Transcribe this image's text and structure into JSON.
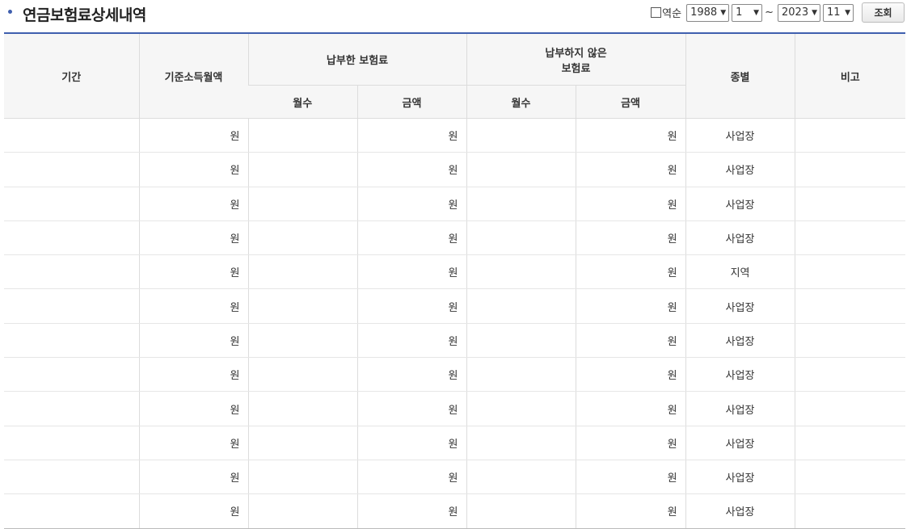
{
  "title": "연금보험료상세내역",
  "controls": {
    "reverse_label": "역순",
    "start_year": "1988",
    "start_month": "1",
    "tilde": "~",
    "end_year": "2023",
    "end_month": "11",
    "search_label": "조회"
  },
  "table": {
    "headers": {
      "period": "기간",
      "base_income": "기준소득월액",
      "paid": "납부한 보험료",
      "unpaid_line1": "납부하지 않은",
      "unpaid_line2": "보험료",
      "months": "월수",
      "amount": "금액",
      "type": "종별",
      "note": "비고"
    },
    "rows": [
      {
        "income": "원",
        "paid": "원",
        "unpaid": "원",
        "type": "사업장"
      },
      {
        "income": "원",
        "paid": "원",
        "unpaid": "원",
        "type": "사업장"
      },
      {
        "income": "원",
        "paid": "원",
        "unpaid": "원",
        "type": "사업장"
      },
      {
        "income": "원",
        "paid": "원",
        "unpaid": "원",
        "type": "사업장"
      },
      {
        "income": "원",
        "paid": "원",
        "unpaid": "원",
        "type": "지역"
      },
      {
        "income": "원",
        "paid": "원",
        "unpaid": "원",
        "type": "사업장"
      },
      {
        "income": "원",
        "paid": "원",
        "unpaid": "원",
        "type": "사업장"
      },
      {
        "income": "원",
        "paid": "원",
        "unpaid": "원",
        "type": "사업장"
      },
      {
        "income": "원",
        "paid": "원",
        "unpaid": "원",
        "type": "사업장"
      },
      {
        "income": "원",
        "paid": "원",
        "unpaid": "원",
        "type": "사업장"
      },
      {
        "income": "원",
        "paid": "원",
        "unpaid": "원",
        "type": "사업장"
      },
      {
        "income": "원",
        "paid": "원",
        "unpaid": "원",
        "type": "사업장"
      }
    ]
  }
}
